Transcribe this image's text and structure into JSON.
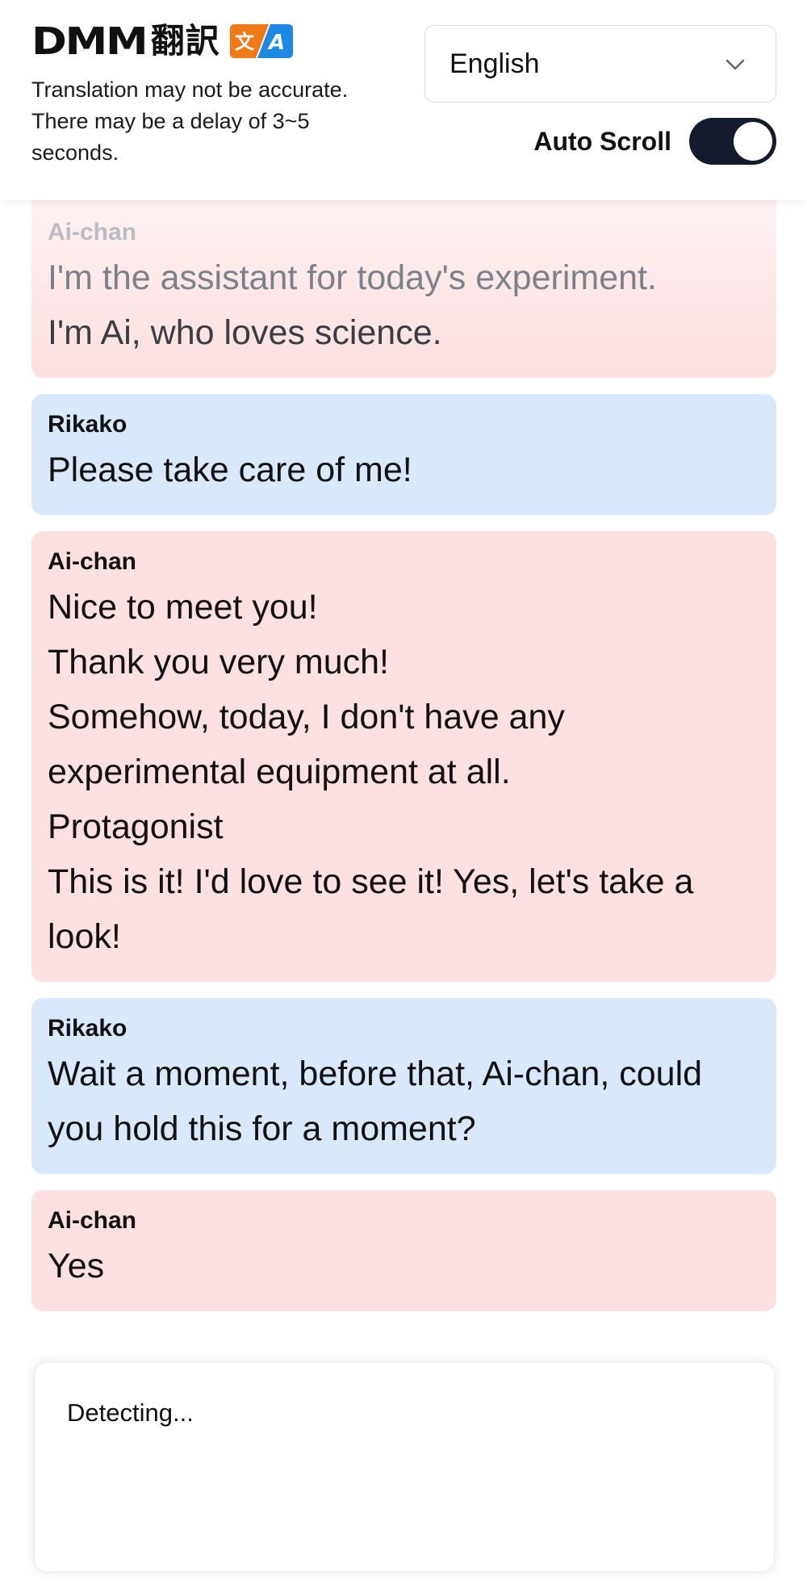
{
  "header": {
    "logo_text": "DMM",
    "logo_jp": "翻訳",
    "badge_left_char": "文",
    "badge_right_char": "A",
    "disclaimer": "Translation may not be accurate. There may be a delay of 3~5 seconds.",
    "language": "English",
    "auto_scroll_label": "Auto Scroll",
    "auto_scroll_on": true
  },
  "colors": {
    "pink_bubble": "#fde0e1",
    "blue_bubble": "#dae8fc",
    "toggle_on": "#141b2d",
    "badge_orange": "#f07a18",
    "badge_blue": "#1e88e5"
  },
  "messages": [
    {
      "speaker": "Ai-chan",
      "lines": [
        "I'm the assistant for today's experiment.",
        "I'm Ai, who loves science."
      ]
    },
    {
      "speaker": "Rikako",
      "lines": [
        "Please take care of me!"
      ]
    },
    {
      "speaker": "Ai-chan",
      "lines": [
        "Nice to meet you!",
        "Thank you very much!",
        "Somehow, today, I don't have any experimental equipment at all.",
        "Protagonist",
        "This is it! I'd love to see it! Yes, let's take a look!"
      ]
    },
    {
      "speaker": "Rikako",
      "lines": [
        "Wait a moment, before that, Ai-chan, could you hold this for a moment?"
      ]
    },
    {
      "speaker": "Ai-chan",
      "lines": [
        "Yes"
      ]
    }
  ],
  "status": {
    "detecting": "Detecting..."
  }
}
